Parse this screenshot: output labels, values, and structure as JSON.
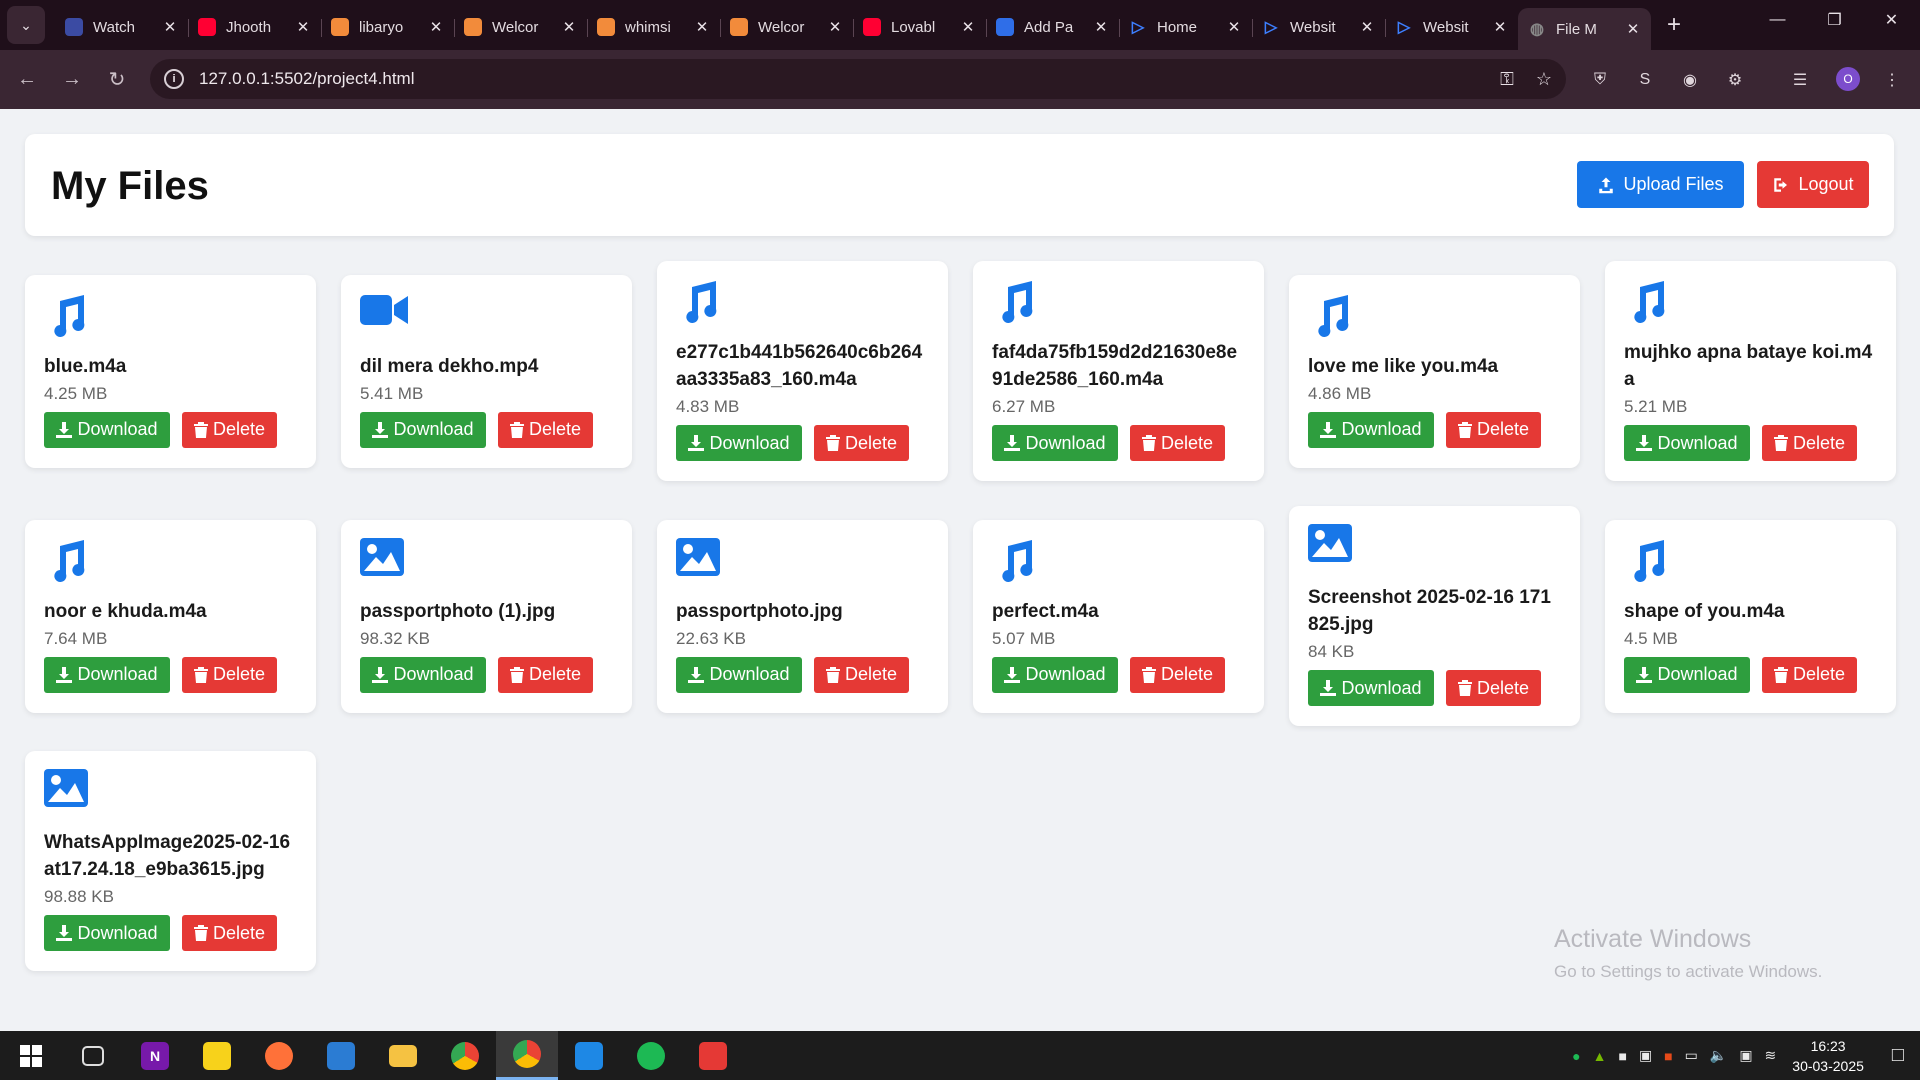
{
  "browser": {
    "tabs": [
      {
        "label": "Watch",
        "favicon": "hianime-icon",
        "color": "#3b4ba3"
      },
      {
        "label": "Jhooth",
        "favicon": "youtube-icon",
        "color": "#ff0033"
      },
      {
        "label": "libaryo",
        "favicon": "heart-icon",
        "color": "#f28b3b"
      },
      {
        "label": "Welcor",
        "favicon": "heart-icon",
        "color": "#f28b3b"
      },
      {
        "label": "whimsi",
        "favicon": "heart-icon",
        "color": "#f28b3b"
      },
      {
        "label": "Welcor",
        "favicon": "heart-icon",
        "color": "#f28b3b"
      },
      {
        "label": "Lovabl",
        "favicon": "youtube-icon",
        "color": "#ff0033"
      },
      {
        "label": "Add Pa",
        "favicon": "confluence-icon",
        "color": "#2f6ee8"
      },
      {
        "label": "Home",
        "favicon": "play-icon",
        "color": "#3d7fff"
      },
      {
        "label": "Websit",
        "favicon": "play-icon",
        "color": "#3d7fff"
      },
      {
        "label": "Websit",
        "favicon": "play-icon",
        "color": "#3d7fff"
      },
      {
        "label": "File M",
        "favicon": "globe-icon",
        "color": "#888888",
        "active": true
      }
    ],
    "url": "127.0.0.1:5502/project4.html",
    "profile_initial": "O"
  },
  "header": {
    "title": "My Files",
    "upload_label": "Upload Files",
    "logout_label": "Logout"
  },
  "labels": {
    "download": "Download",
    "delete": "Delete"
  },
  "files": [
    {
      "name": "blue.m4a",
      "size": "4.25 MB",
      "type": "audio"
    },
    {
      "name": "dil mera dekho.mp4",
      "size": "5.41 MB",
      "type": "video"
    },
    {
      "name": "e277c1b441b562640c6b264aa3335a83_160.m4a",
      "size": "4.83 MB",
      "type": "audio"
    },
    {
      "name": "faf4da75fb159d2d21630e8e91de2586_160.m4a",
      "size": "6.27 MB",
      "type": "audio"
    },
    {
      "name": "love me like you.m4a",
      "size": "4.86 MB",
      "type": "audio"
    },
    {
      "name": "mujhko apna bataye koi.m4a",
      "size": "5.21 MB",
      "type": "audio"
    },
    {
      "name": "noor e khuda.m4a",
      "size": "7.64 MB",
      "type": "audio"
    },
    {
      "name": "passportphoto (1).jpg",
      "size": "98.32 KB",
      "type": "image"
    },
    {
      "name": "passportphoto.jpg",
      "size": "22.63 KB",
      "type": "image"
    },
    {
      "name": "perfect.m4a",
      "size": "5.07 MB",
      "type": "audio"
    },
    {
      "name": "Screenshot 2025-02-16 171825.jpg",
      "size": "84 KB",
      "type": "image"
    },
    {
      "name": "shape of you.m4a",
      "size": "4.5 MB",
      "type": "audio"
    },
    {
      "name": "WhatsAppImage2025-02-16at17.24.18_e9ba3615.jpg",
      "size": "98.88 KB",
      "type": "image"
    }
  ],
  "watermark": {
    "line1": "Activate Windows",
    "line2": "Go to Settings to activate Windows."
  },
  "taskbar": {
    "apps": [
      "start-icon",
      "task-view-icon",
      "onenote-icon",
      "sticky-notes-icon",
      "firefox-icon",
      "store-icon",
      "file-explorer-icon",
      "chrome-icon",
      "chrome-profile-icon",
      "vscode-icon",
      "spotify-icon",
      "app-icon"
    ],
    "time": "16:23",
    "date": "30-03-2025"
  },
  "colors": {
    "primary": "#1877e8",
    "danger": "#e53935",
    "success": "#2e9e3e",
    "icon_blue": "#1877e8"
  }
}
